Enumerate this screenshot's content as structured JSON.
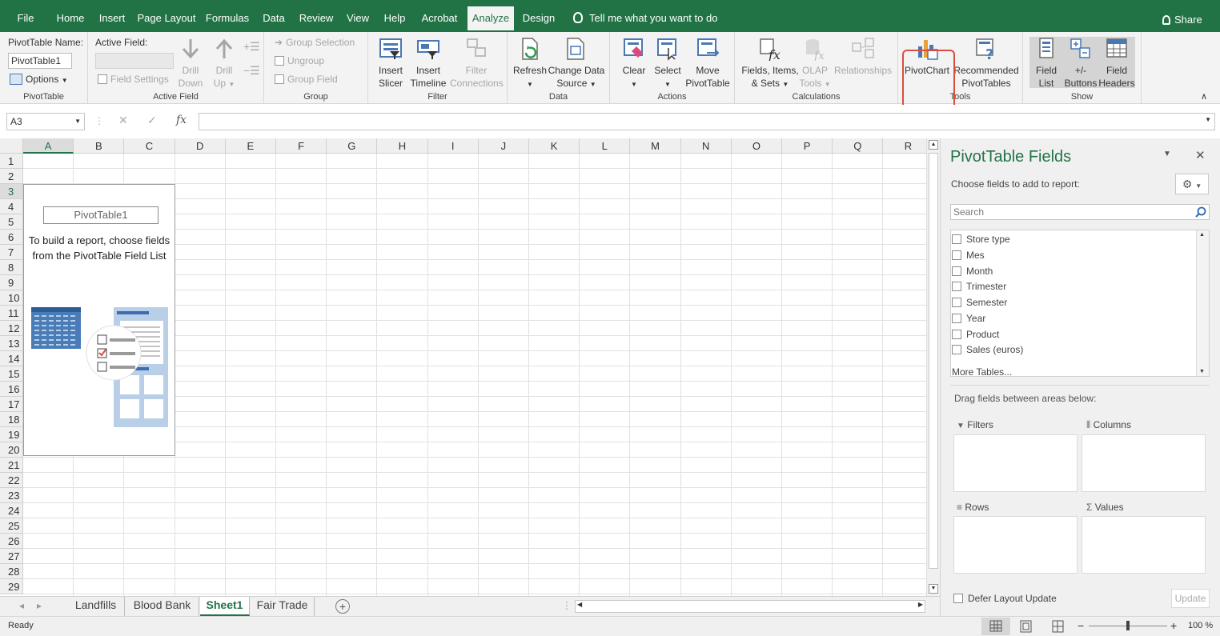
{
  "tabs": [
    "File",
    "Home",
    "Insert",
    "Page Layout",
    "Formulas",
    "Data",
    "Review",
    "View",
    "Help",
    "Acrobat",
    "Analyze",
    "Design"
  ],
  "tell_me": "Tell me what you want to do",
  "share": "Share",
  "ribbon": {
    "pt_name_label": "PivotTable Name:",
    "pt_name_value": "PivotTable1",
    "options": "Options",
    "pt_group": "PivotTable",
    "active_field_label": "Active Field:",
    "field_settings": "Field Settings",
    "drill_down": [
      "Drill",
      "Down"
    ],
    "drill_up": [
      "Drill",
      "Up"
    ],
    "active_field_group": "Active Field",
    "group_selection": "Group Selection",
    "ungroup": "Ungroup",
    "group_field": "Group Field",
    "group_group": "Group",
    "insert_slicer": [
      "Insert",
      "Slicer"
    ],
    "insert_timeline": [
      "Insert",
      "Timeline"
    ],
    "filter_connections": [
      "Filter",
      "Connections"
    ],
    "filter_group": "Filter",
    "refresh": "Refresh",
    "change_data_source": [
      "Change Data",
      "Source"
    ],
    "data_group": "Data",
    "clear": "Clear",
    "select": "Select",
    "move_pivottable": [
      "Move",
      "PivotTable"
    ],
    "actions_group": "Actions",
    "fields_items_sets": [
      "Fields, Items,",
      "& Sets"
    ],
    "olap_tools": [
      "OLAP",
      "Tools"
    ],
    "relationships": "Relationships",
    "calculations_group": "Calculations",
    "pivotchart": "PivotChart",
    "recommended_pivottables": [
      "Recommended",
      "PivotTables"
    ],
    "tools_group": "Tools",
    "field_list": [
      "Field",
      "List"
    ],
    "plus_minus_buttons": [
      "+/-",
      "Buttons"
    ],
    "field_headers": [
      "Field",
      "Headers"
    ],
    "show_group": "Show"
  },
  "name_box": "A3",
  "fx": "fx",
  "columns": [
    "A",
    "B",
    "C",
    "D",
    "E",
    "F",
    "G",
    "H",
    "I",
    "J",
    "K",
    "L",
    "M",
    "N",
    "O",
    "P",
    "Q",
    "R"
  ],
  "rows": [
    "1",
    "2",
    "3",
    "4",
    "5",
    "6",
    "7",
    "8",
    "9",
    "10",
    "11",
    "12",
    "13",
    "14",
    "15",
    "16",
    "17",
    "18",
    "19",
    "20",
    "21",
    "22",
    "23",
    "24",
    "25",
    "26",
    "27",
    "28",
    "29"
  ],
  "pivot_placeholder": {
    "name": "PivotTable1",
    "line1": "To build a report, choose fields",
    "line2": "from the PivotTable Field List"
  },
  "sheet_tabs": [
    "Landfills",
    "Blood Bank",
    "Sheet1",
    "Fair Trade"
  ],
  "active_sheet": "Sheet1",
  "status": "Ready",
  "zoom": "100 %",
  "pane": {
    "title": "PivotTable Fields",
    "choose": "Choose fields to add to report:",
    "search_placeholder": "Search",
    "fields": [
      "Store type",
      "Mes",
      "Month",
      "Trimester",
      "Semester",
      "Year",
      "Product",
      "Sales (euros)"
    ],
    "more_tables": "More Tables...",
    "drag_hint": "Drag fields between areas below:",
    "filters": "Filters",
    "columns": "Columns",
    "rows": "Rows",
    "values": "Values",
    "defer": "Defer Layout Update",
    "update": "Update"
  },
  "colors": {
    "brand": "#217346",
    "highlight": "#d94f3d"
  }
}
